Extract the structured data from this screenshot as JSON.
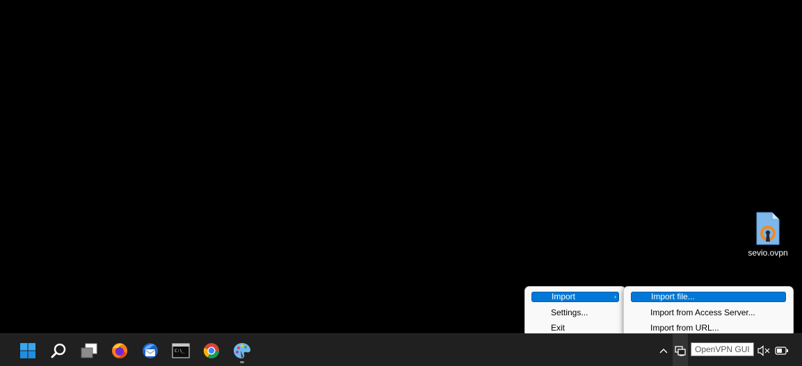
{
  "desktop": {
    "icons": [
      {
        "label": "sevio.ovpn",
        "icon": "ovpn-file-icon"
      }
    ]
  },
  "context_menu": {
    "items": [
      {
        "label": "Import",
        "has_submenu": true,
        "active": true
      },
      {
        "label": "Settings...",
        "has_submenu": false,
        "active": false
      },
      {
        "label": "Exit",
        "has_submenu": false,
        "active": false
      }
    ],
    "submenu_arrow": "›"
  },
  "submenu": {
    "items": [
      {
        "label": "Import file...",
        "active": true
      },
      {
        "label": "Import from Access Server...",
        "active": false
      },
      {
        "label": "Import from URL...",
        "active": false
      }
    ]
  },
  "taskbar": {
    "apps": [
      {
        "name": "start",
        "icon": "windows-start-icon"
      },
      {
        "name": "search",
        "icon": "search-icon"
      },
      {
        "name": "task-view",
        "icon": "task-view-icon"
      },
      {
        "name": "firefox",
        "icon": "firefox-icon"
      },
      {
        "name": "thunderbird",
        "icon": "thunderbird-icon"
      },
      {
        "name": "terminal",
        "icon": "terminal-icon"
      },
      {
        "name": "chrome",
        "icon": "chrome-icon"
      },
      {
        "name": "paint",
        "icon": "paint-icon",
        "running": true
      }
    ],
    "tray": {
      "chevron": "^",
      "tooltip": "OpenVPN GUI",
      "icons": [
        "show-hidden-icons-chevron",
        "openvpn-tray-icon",
        "volume-muted-icon",
        "battery-icon"
      ]
    }
  },
  "colors": {
    "desktop_bg": "#000000",
    "taskbar_bg": "#202020",
    "menu_bg": "#f9f9f9",
    "highlight": "#0078d7",
    "openvpn_orange": "#f08a24",
    "file_blue": "#7fb7ea"
  }
}
